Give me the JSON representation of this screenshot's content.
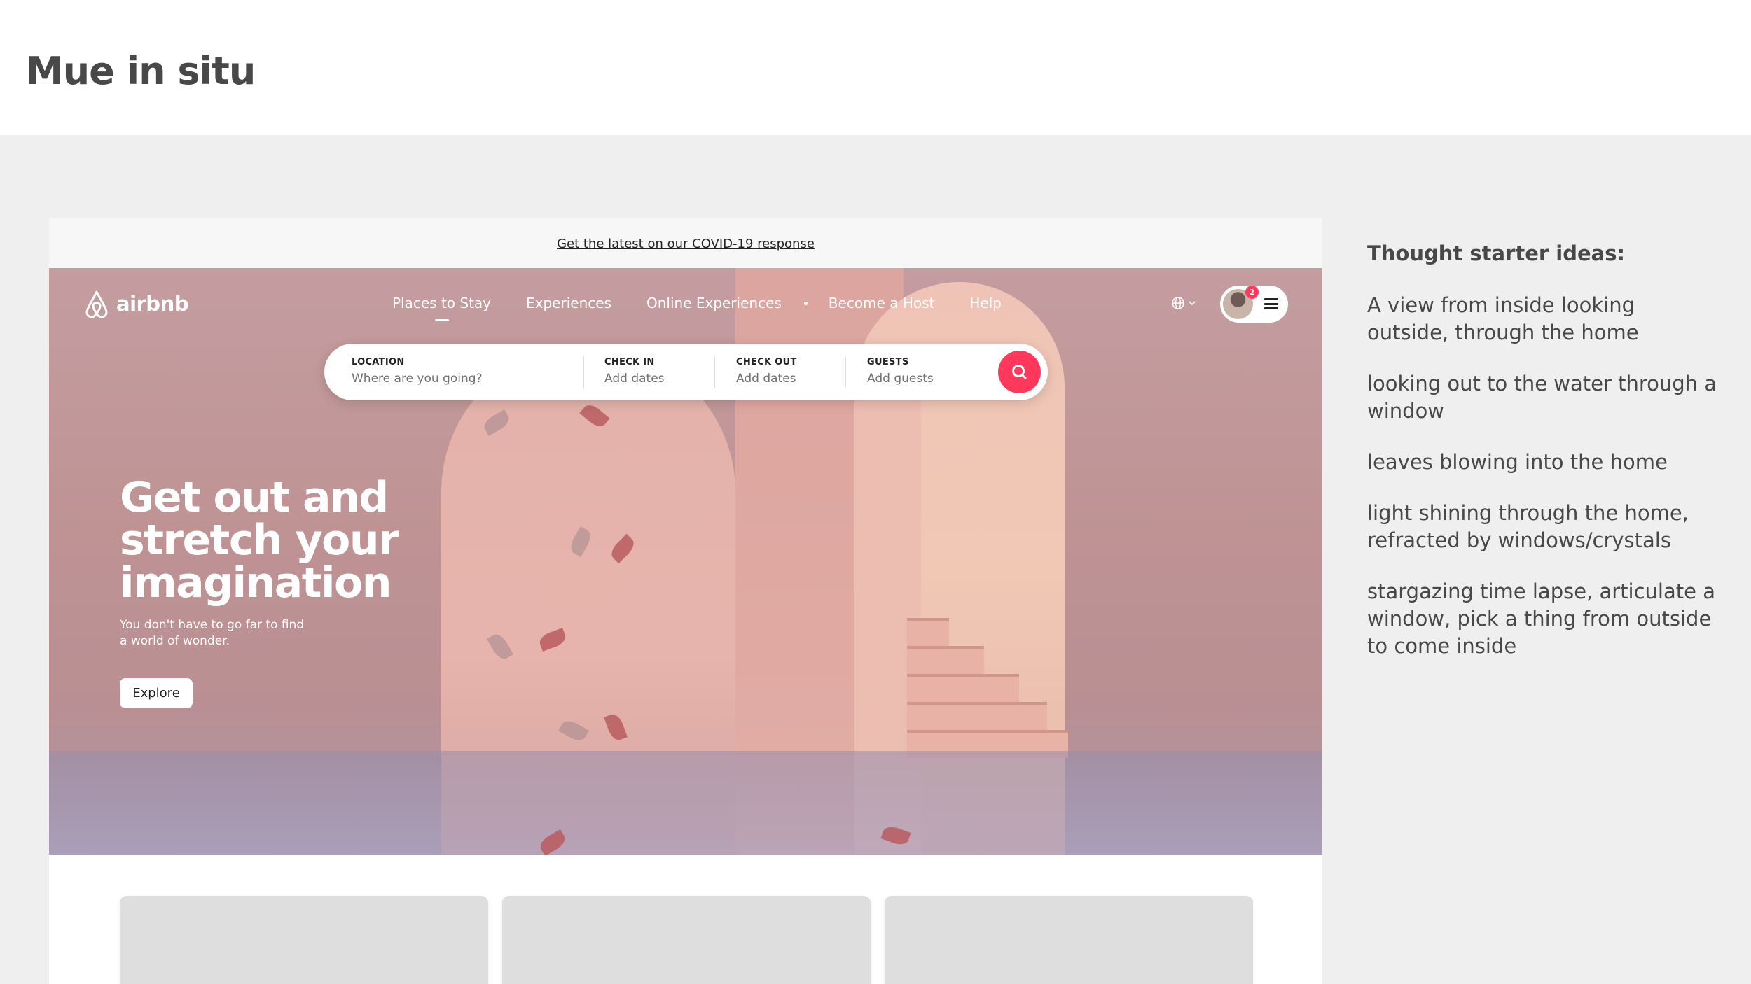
{
  "slide": {
    "title": "Mue in situ"
  },
  "mockup": {
    "covid_link": "Get the latest on our COVID-19 response",
    "logo_text": "airbnb",
    "nav": [
      {
        "label": "Places to Stay",
        "active": true
      },
      {
        "label": "Experiences"
      },
      {
        "label": "Online Experiences"
      },
      {
        "label": "Become a Host"
      },
      {
        "label": "Help"
      }
    ],
    "notification_count": "2",
    "search": {
      "location": {
        "label": "LOCATION",
        "placeholder": "Where are you going?"
      },
      "check_in": {
        "label": "CHECK IN",
        "placeholder": "Add dates"
      },
      "check_out": {
        "label": "CHECK OUT",
        "placeholder": "Add dates"
      },
      "guests": {
        "label": "GUESTS",
        "placeholder": "Add guests"
      }
    },
    "hero": {
      "title": "Get out and stretch your imagination",
      "subtitle": "You don't have to go far to find a world of wonder.",
      "cta": "Explore"
    },
    "brand_color": "#ff385c"
  },
  "notes": {
    "heading": "Thought starter ideas:",
    "items": [
      "A view from inside looking outside, through the home",
      "looking out to the water through a window",
      "leaves blowing into the home",
      "light shining through the home, refracted by windows/crystals",
      "stargazing time lapse, articulate a window, pick a thing from outside to come inside"
    ]
  }
}
